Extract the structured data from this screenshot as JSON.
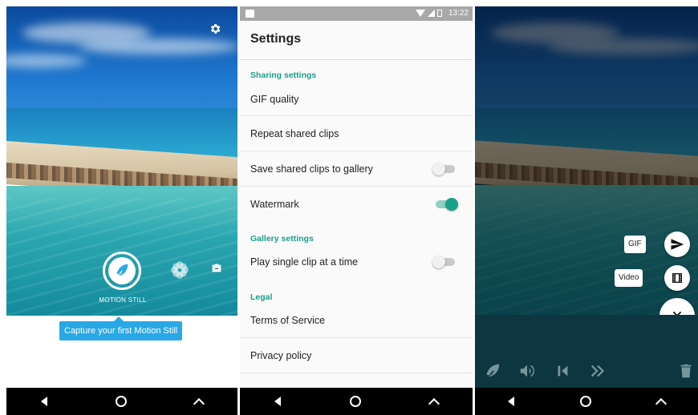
{
  "panel1": {
    "shutter_label": "MOTION STILL",
    "tooltip": "Capture your first Motion Still",
    "icons": [
      "gear-icon",
      "motion-still-icon",
      "flower-icon",
      "camera-switch-icon"
    ]
  },
  "panel2": {
    "status_time": "13:22",
    "title": "Settings",
    "sections": {
      "sharing": "Sharing settings",
      "gallery": "Gallery settings",
      "legal": "Legal"
    },
    "rows": {
      "gif_quality": "GIF quality",
      "repeat": "Repeat shared clips",
      "save_gallery": "Save shared clips to gallery",
      "watermark": "Watermark",
      "play_single": "Play single clip at a time",
      "tos": "Terms of Service",
      "privacy": "Privacy policy"
    },
    "toggles": {
      "save_gallery": false,
      "watermark": true,
      "play_single": false
    },
    "accent_color": "#1a9f8a"
  },
  "panel3": {
    "gif_chip": "GIF",
    "video_chip": "Video",
    "icons": [
      "send-icon",
      "film-icon",
      "close-icon",
      "motion-icon",
      "volume-icon",
      "bounce-icon",
      "fast-forward-icon",
      "trash-icon"
    ]
  }
}
